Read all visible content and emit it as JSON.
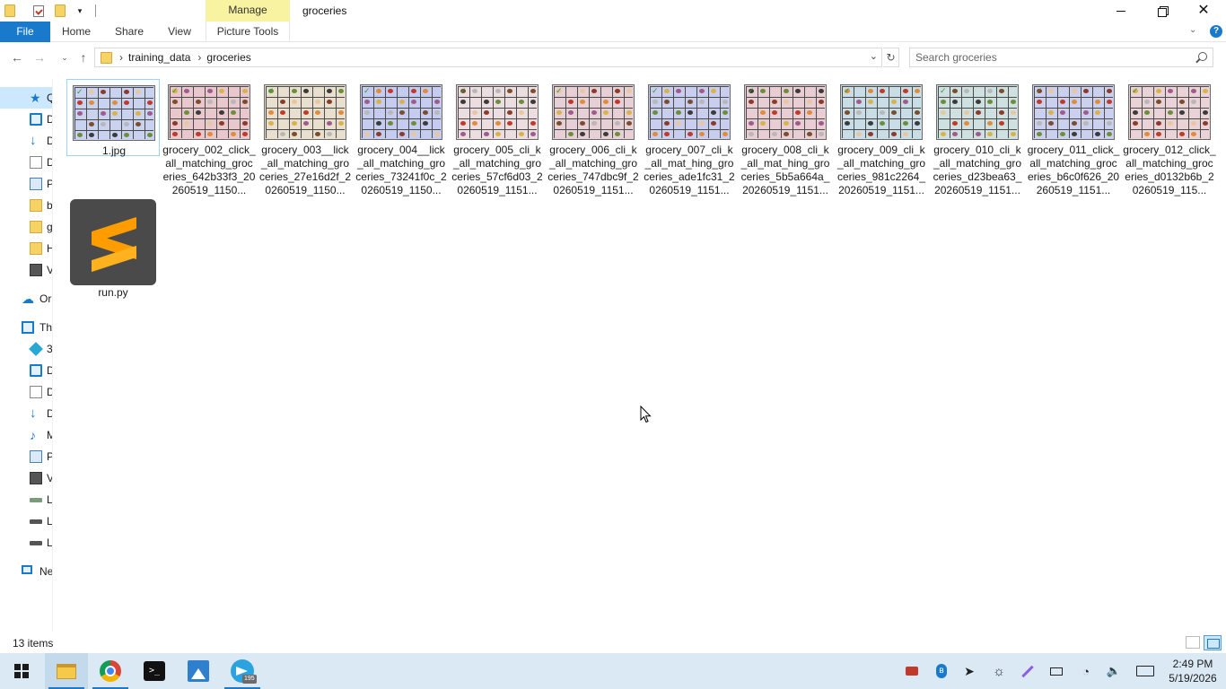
{
  "window": {
    "title": "groceries",
    "manage_label": "Manage"
  },
  "ribbon": {
    "tabs": [
      {
        "label": "File"
      },
      {
        "label": "Home"
      },
      {
        "label": "Share"
      },
      {
        "label": "View"
      },
      {
        "label": "Picture Tools"
      }
    ]
  },
  "address": {
    "breadcrumbs": [
      "training_data",
      "groceries"
    ],
    "search_placeholder": "Search groceries"
  },
  "navpane": {
    "items": [
      {
        "label": "Qu",
        "icon": "star-icon"
      },
      {
        "label": "D",
        "icon": "desktop-icon"
      },
      {
        "label": "D",
        "icon": "downloads-icon"
      },
      {
        "label": "D",
        "icon": "documents-icon"
      },
      {
        "label": "P",
        "icon": "pictures-icon"
      },
      {
        "label": "b",
        "icon": "folder-icon"
      },
      {
        "label": "g",
        "icon": "folder-icon"
      },
      {
        "label": "H",
        "icon": "folder-icon"
      },
      {
        "label": "V",
        "icon": "videos-icon"
      },
      {
        "label": "Or",
        "icon": "onedrive-icon"
      },
      {
        "label": "Th",
        "icon": "this-pc-icon"
      },
      {
        "label": "3",
        "icon": "3d-objects-icon"
      },
      {
        "label": "D",
        "icon": "desktop-icon"
      },
      {
        "label": "D",
        "icon": "documents-icon"
      },
      {
        "label": "D",
        "icon": "downloads-icon"
      },
      {
        "label": "M",
        "icon": "music-icon"
      },
      {
        "label": "P",
        "icon": "pictures-icon"
      },
      {
        "label": "V",
        "icon": "videos-icon"
      },
      {
        "label": "L",
        "icon": "drive-icon"
      },
      {
        "label": "L",
        "icon": "drive-icon"
      },
      {
        "label": "L",
        "icon": "drive-icon"
      },
      {
        "label": "Ne",
        "icon": "network-icon"
      }
    ]
  },
  "files": [
    {
      "name": "1.jpg",
      "tint": "#c9d3f0"
    },
    {
      "name": "grocery_002_click_all_matching_groceries_642b33f3_20260519_1150...",
      "tint": "#e8c8cc"
    },
    {
      "name": "grocery_003__lick_all_matching_groceries_27e16d2f_20260519_1150...",
      "tint": "#e9dfcf"
    },
    {
      "name": "grocery_004__lick_all_matching_groceries_73241f0c_20260519_1150...",
      "tint": "#c6ccef"
    },
    {
      "name": "grocery_005_cli_k_all_matching_groceries_57cf6d03_20260519_1151...",
      "tint": "#ecdde0"
    },
    {
      "name": "grocery_006_cli_k_all_matching_groceries_747dbc9f_20260519_1151...",
      "tint": "#e6d0d6"
    },
    {
      "name": "grocery_007_cli_k_all_mat_hing_groceries_ade1fc31_20260519_1151...",
      "tint": "#c9cdee"
    },
    {
      "name": "grocery_008_cli_k_all_mat_hing_groceries_5b5a664a_20260519_1151...",
      "tint": "#e8cdd2"
    },
    {
      "name": "grocery_009_cli_k_all_matching_groceries_981c2264_20260519_1151...",
      "tint": "#c8dde6"
    },
    {
      "name": "grocery_010_cli_k_all_matching_groceries_d23bea63_20260519_1151...",
      "tint": "#cfe0e0"
    },
    {
      "name": "grocery_011_click_all_matching_groceries_b6c0f626_20260519_1151...",
      "tint": "#cbd0ef"
    },
    {
      "name": "grocery_012_click_all_matching_groceries_d0132b6b_20260519_115...",
      "tint": "#ead3d6"
    }
  ],
  "script_file": {
    "name": "run.py",
    "icon": "sublime-text-icon"
  },
  "status": {
    "count": "13 items"
  },
  "taskbar": {
    "apps": [
      "file-explorer",
      "chrome",
      "terminal",
      "photos",
      "telegram"
    ],
    "telegram_badge": "195",
    "time": "2:49 PM",
    "date": "5/19/2026"
  },
  "colors": {
    "accent": "#1979ca",
    "manage_tab": "#f7f3a1",
    "selection": "#cce8ff",
    "taskbar": "#dbe9f4"
  }
}
